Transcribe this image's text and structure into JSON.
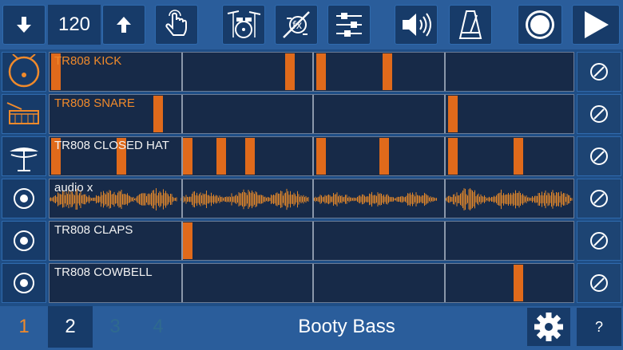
{
  "toolbar": {
    "bpm": "120",
    "buttons": [
      "arrow-down-icon",
      "arrow-up-icon",
      "touch-hand-icon",
      "drum-kit-icon",
      "fx-icon",
      "mixer-sliders-icon",
      "speaker-icon",
      "metronome-icon",
      "record-icon",
      "play-icon"
    ]
  },
  "tracks": [
    {
      "name": "TR808 KICK",
      "icon": "kick-drum-icon",
      "highlight": true,
      "hits": [
        0.0,
        0.445,
        0.505,
        0.63
      ]
    },
    {
      "name": "TR808 SNARE",
      "icon": "snare-drum-icon",
      "highlight": true,
      "hits": [
        0.195,
        0.755
      ]
    },
    {
      "name": "TR808 CLOSED HAT",
      "icon": "hihat-icon",
      "highlight": false,
      "hits": [
        0.0,
        0.125,
        0.25,
        0.315,
        0.37,
        0.505,
        0.625,
        0.755,
        0.88
      ]
    },
    {
      "name": "audio x",
      "icon": "record-track-icon",
      "highlight": false,
      "hits": []
    },
    {
      "name": "TR808 CLAPS",
      "icon": "record-track-icon",
      "highlight": false,
      "hits": [
        0.25
      ]
    },
    {
      "name": "TR808 COWBELL",
      "icon": "record-track-icon",
      "highlight": false,
      "hits": [
        0.88
      ]
    }
  ],
  "bottom": {
    "pages": [
      {
        "label": "1",
        "color": "#f08a2b"
      },
      {
        "label": "2",
        "color": "#ffffff"
      },
      {
        "label": "3",
        "color": "#2f6a8f"
      },
      {
        "label": "4",
        "color": "#2f6a8f"
      }
    ],
    "title": "Booty Bass",
    "help": "?"
  },
  "colors": {
    "accent": "#e06a1b",
    "toolbar": "#2a5d9b",
    "button": "#173b69",
    "lane": "#172a48"
  }
}
